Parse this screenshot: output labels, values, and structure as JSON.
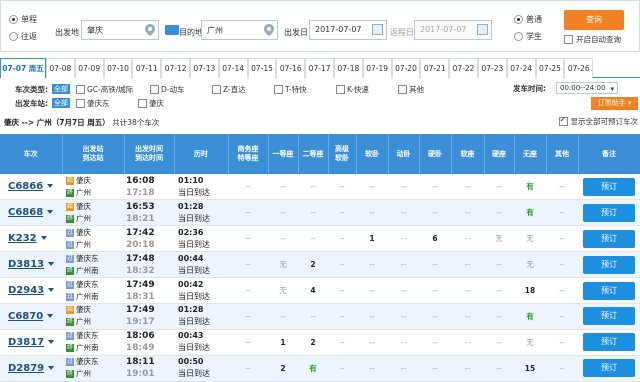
{
  "search": {
    "one_way": "单程",
    "round_trip": "往返",
    "from_label": "出发地",
    "from_value": "肇庆",
    "to_label": "目的地",
    "to_value": "广州",
    "date_label": "出发日",
    "date_value": "2017-07-07",
    "return_label": "返程日",
    "return_value": "2017-07-07",
    "normal": "普通",
    "student": "学生",
    "query_btn": "查询",
    "auto_query": "开启自动查询"
  },
  "date_tabs": [
    "07-07 周五",
    "07-08",
    "07-09",
    "07-10",
    "07-11",
    "07-12",
    "07-13",
    "07-14",
    "07-15",
    "07-16",
    "07-17",
    "07-18",
    "07-19",
    "07-20",
    "07-21",
    "07-22",
    "07-23",
    "07-24",
    "07-25",
    "07-26"
  ],
  "filters": {
    "type_label": "车次类型:",
    "all": "全部",
    "types": [
      "GC-高铁/城际",
      "D-动车",
      "Z-直达",
      "T-特快",
      "K-快速",
      "其他"
    ],
    "depart_label": "发车时间:",
    "depart_value": "00:00--24:00",
    "station_label": "出发车站:",
    "stations": [
      "肇庆东",
      "肇庆"
    ],
    "order_help": "订票助手"
  },
  "route": {
    "title": "肇庆 --> 广州（7月7日  周五）",
    "count": "共计38个车次",
    "show_all": "显示全部可预订车次"
  },
  "headers": [
    "车次",
    "出发站\n到达站",
    "出发时间\n到达时间",
    "历时",
    "商务座\n特等座",
    "一等座",
    "二等座",
    "高级\n软卧",
    "软卧",
    "动卧",
    "硬卧",
    "软座",
    "硬座",
    "无座",
    "其他",
    "备注"
  ],
  "rows": [
    {
      "no": "C6866",
      "from": "肇庆",
      "to": "广州",
      "fi": "始",
      "ti": "终",
      "dep": "16:08",
      "arr": "17:18",
      "dur": "01:10",
      "day": "当日到达",
      "c": [
        "--",
        "--",
        "--",
        "--",
        "--",
        "--",
        "--",
        "--",
        "--",
        "有",
        "--"
      ],
      "btn": "预订"
    },
    {
      "no": "C6868",
      "from": "肇庆",
      "to": "广州",
      "fi": "始",
      "ti": "终",
      "dep": "16:53",
      "arr": "18:21",
      "dur": "01:28",
      "day": "当日到达",
      "c": [
        "--",
        "--",
        "--",
        "--",
        "--",
        "--",
        "--",
        "--",
        "--",
        "有",
        "--"
      ],
      "btn": "预订"
    },
    {
      "no": "K232",
      "from": "肇庆",
      "to": "广州",
      "fi": "过",
      "ti": "过",
      "dep": "17:42",
      "arr": "20:18",
      "dur": "02:36",
      "day": "当日到达",
      "c": [
        "--",
        "--",
        "--",
        "--",
        "1",
        "--",
        "6",
        "--",
        "无",
        "无",
        "--"
      ],
      "btn": "预订"
    },
    {
      "no": "D3813",
      "from": "肇庆东",
      "to": "广州南",
      "fi": "过",
      "ti": "终",
      "dep": "17:48",
      "arr": "18:32",
      "dur": "00:44",
      "day": "当日到达",
      "c": [
        "--",
        "无",
        "2",
        "--",
        "--",
        "--",
        "--",
        "--",
        "--",
        "无",
        "--"
      ],
      "btn": "预订"
    },
    {
      "no": "D2943",
      "from": "肇庆东",
      "to": "广州南",
      "fi": "过",
      "ti": "过",
      "dep": "17:49",
      "arr": "18:31",
      "dur": "00:42",
      "day": "当日到达",
      "c": [
        "--",
        "无",
        "4",
        "--",
        "--",
        "--",
        "--",
        "--",
        "--",
        "18",
        "--"
      ],
      "btn": "预订"
    },
    {
      "no": "C6870",
      "from": "肇庆",
      "to": "广州",
      "fi": "始",
      "ti": "终",
      "dep": "17:49",
      "arr": "19:17",
      "dur": "01:28",
      "day": "当日到达",
      "c": [
        "--",
        "--",
        "--",
        "--",
        "--",
        "--",
        "--",
        "--",
        "--",
        "有",
        "--"
      ],
      "btn": "预订"
    },
    {
      "no": "D3817",
      "from": "肇庆东",
      "to": "广州南",
      "fi": "过",
      "ti": "终",
      "dep": "18:06",
      "arr": "18:49",
      "dur": "00:43",
      "day": "当日到达",
      "c": [
        "--",
        "1",
        "2",
        "--",
        "--",
        "--",
        "--",
        "--",
        "--",
        "无",
        "--"
      ],
      "btn": "预订"
    },
    {
      "no": "D2879",
      "from": "肇庆东",
      "to": "广州",
      "fi": "过",
      "ti": "终",
      "dep": "18:11",
      "arr": "19:01",
      "dur": "00:50",
      "day": "当日到达",
      "c": [
        "--",
        "2",
        "有",
        "--",
        "--",
        "--",
        "--",
        "--",
        "--",
        "15",
        "--"
      ],
      "btn": "预订"
    }
  ]
}
